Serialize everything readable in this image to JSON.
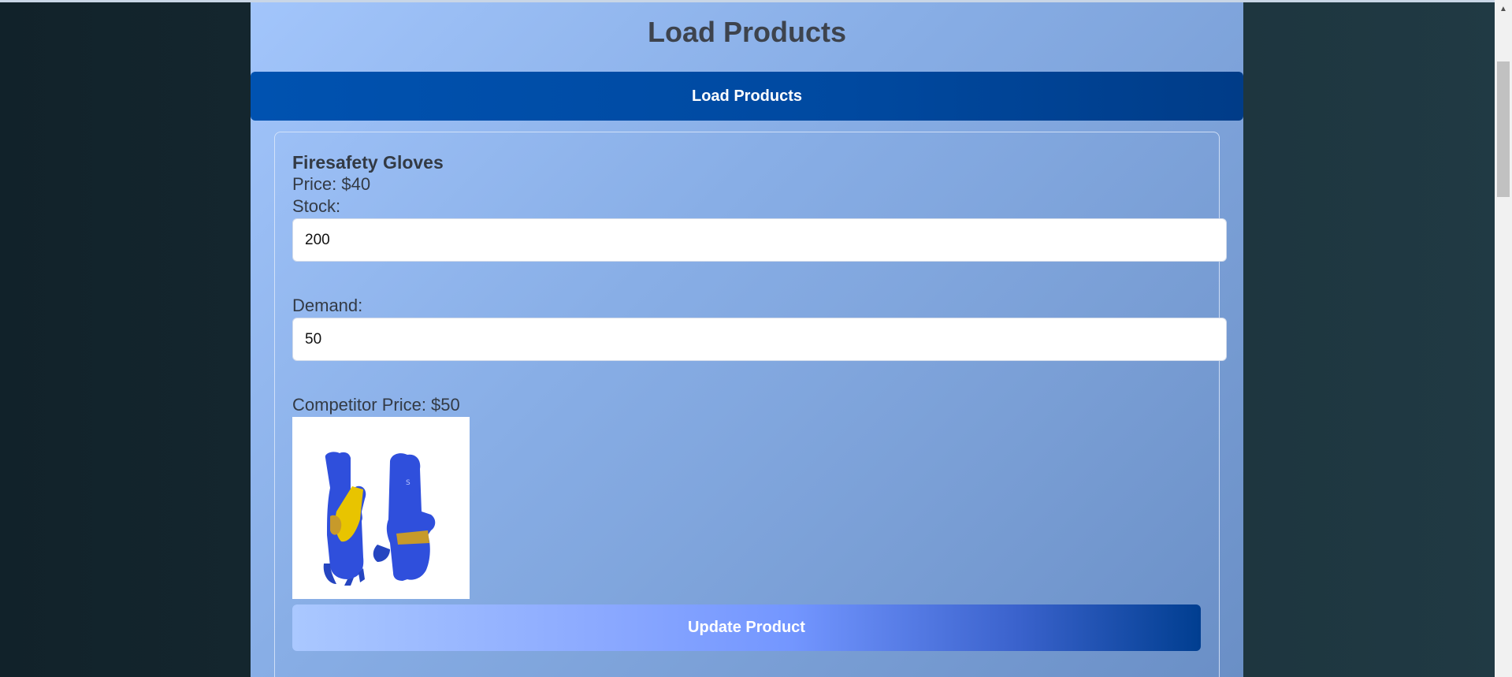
{
  "page": {
    "title": "Load Products"
  },
  "toolbar": {
    "load_label": "Load Products"
  },
  "product": {
    "name": "Firesafety Gloves",
    "price_text": "Price: $40",
    "stock_label": "Stock:",
    "stock_value": "200",
    "demand_label": "Demand:",
    "demand_value": "50",
    "competitor_price_text": "Competitor Price: $50",
    "image_alt": "gloves-image",
    "update_label": "Update Product"
  },
  "colors": {
    "panel_gradient_start": "#a2c5fb",
    "panel_gradient_end": "#6a8fc6",
    "load_button": "#0052b0",
    "update_button_start": "#aac8ff",
    "update_button_end": "#003e90",
    "glove_blue": "#2f4fdc",
    "glove_yellow": "#e8c400"
  },
  "icons": {
    "scroll_up": "triangle-up-icon"
  }
}
